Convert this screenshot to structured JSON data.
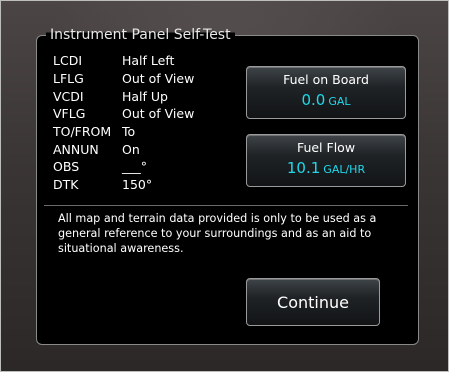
{
  "panel": {
    "title": "Instrument Panel Self-Test"
  },
  "status": [
    {
      "key": "LCDI",
      "value": "Half Left"
    },
    {
      "key": "LFLG",
      "value": "Out of View"
    },
    {
      "key": "VCDI",
      "value": "Half Up"
    },
    {
      "key": "VFLG",
      "value": "Out of View"
    },
    {
      "key": "TO/FROM",
      "value": "To"
    },
    {
      "key": "ANNUN",
      "value": "On"
    },
    {
      "key": "OBS",
      "value": "___°"
    },
    {
      "key": "DTK",
      "value": "150°"
    }
  ],
  "fuel_on_board": {
    "label": "Fuel on Board",
    "value": "0.0",
    "unit": "GAL"
  },
  "fuel_flow": {
    "label": "Fuel Flow",
    "value": "10.1",
    "unit": "GAL/HR"
  },
  "disclaimer": "All map and terrain data provided is only to be used as a general reference to your surroundings and as an aid to situational awareness.",
  "continue_label": "Continue",
  "colors": {
    "readout_value": "#21d8ea",
    "panel_background": "#000000"
  }
}
